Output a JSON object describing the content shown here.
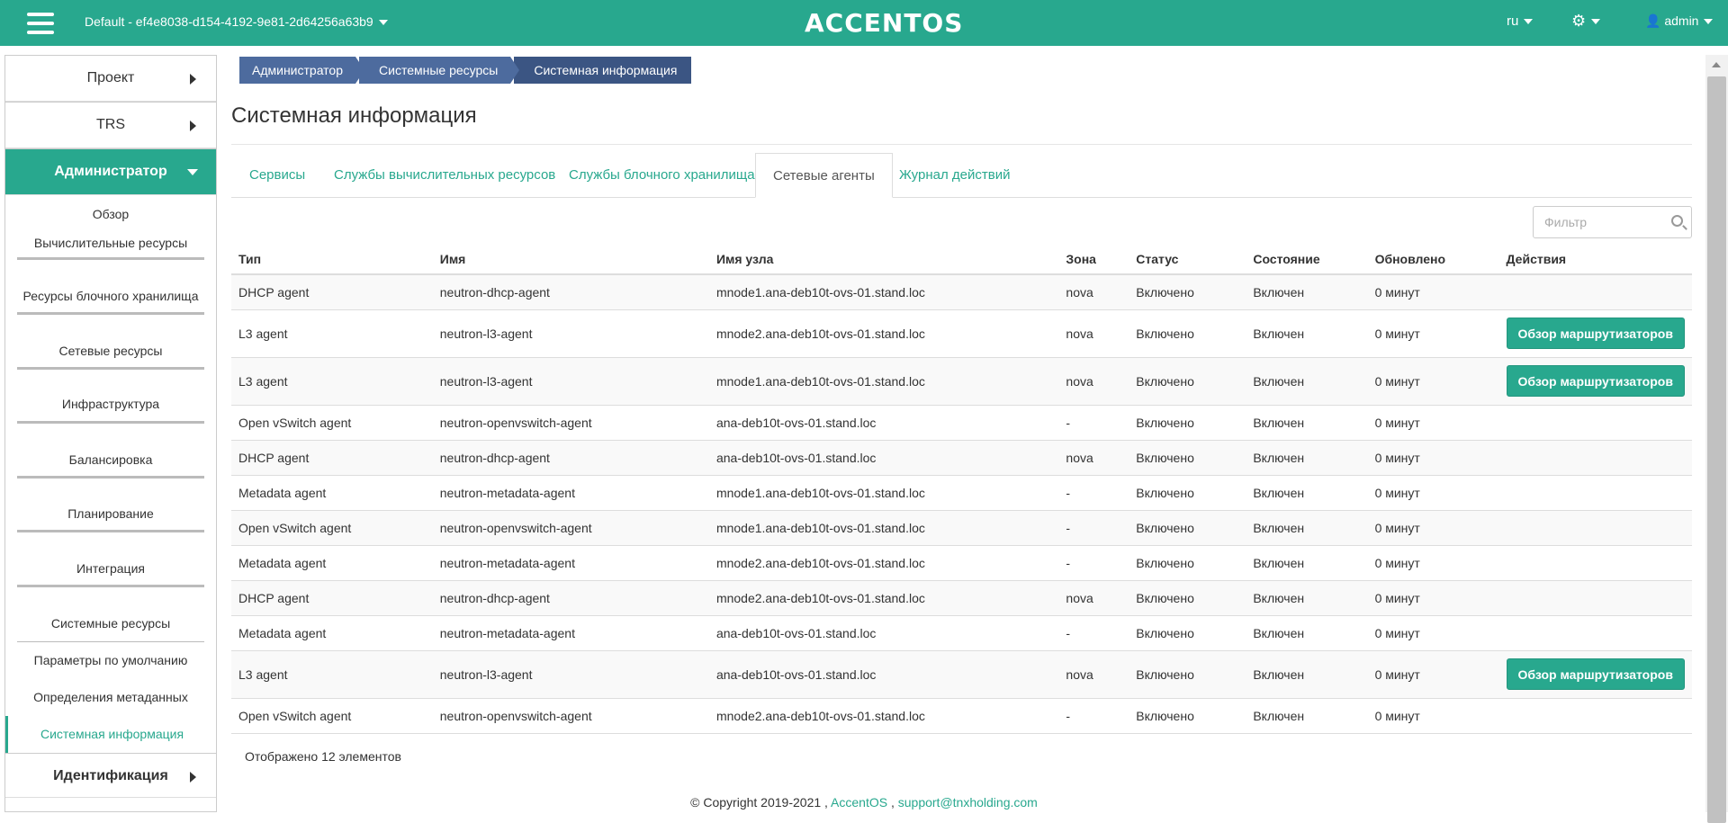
{
  "topbar": {
    "project": "Default - ef4e8038-d154-4192-9e81-2d64256a63b9",
    "logo": "ACCENTOS",
    "lang": "ru",
    "settings_icon": "gear-icon",
    "user": "admin",
    "color": "#28a88e"
  },
  "sidebar": {
    "sections": [
      {
        "label": "Проект"
      },
      {
        "label": "TRS"
      },
      {
        "label": "Администратор"
      }
    ],
    "items": [
      {
        "label": "Обзор"
      },
      {
        "label": "Вычислительные ресурсы"
      },
      {
        "label": "Ресурсы блочного хранилища"
      },
      {
        "label": "Сетевые ресурсы"
      },
      {
        "label": "Инфраструктура"
      },
      {
        "label": "Балансировка"
      },
      {
        "label": "Планирование"
      },
      {
        "label": "Интеграция"
      },
      {
        "label": "Системные ресурсы"
      }
    ],
    "subitems": [
      {
        "label": "Параметры по умолчанию"
      },
      {
        "label": "Определения метаданных"
      },
      {
        "label": "Системная информация"
      }
    ],
    "bottom_section": "Идентификация"
  },
  "breadcrumb": [
    "Администратор",
    "Системные ресурсы",
    "Системная информация"
  ],
  "page_title": "Системная информация",
  "tabs": [
    "Сервисы",
    "Службы вычислительных ресурсов",
    "Службы блочного хранилища",
    "Сетевые агенты",
    "Журнал действий"
  ],
  "filter": {
    "placeholder": "Фильтр"
  },
  "table": {
    "headers": [
      "Тип",
      "Имя",
      "Имя узла",
      "Зона",
      "Статус",
      "Состояние",
      "Обновлено",
      "Действия"
    ],
    "action_label": "Обзор маршрутизаторов",
    "rows": [
      {
        "type": "DHCP agent",
        "name": "neutron-dhcp-agent",
        "host": "mnode1.ana-deb10t-ovs-01.stand.loc",
        "zone": "nova",
        "status": "Включено",
        "state": "Включен",
        "updated": "0 минут",
        "action": false
      },
      {
        "type": "L3 agent",
        "name": "neutron-l3-agent",
        "host": "mnode2.ana-deb10t-ovs-01.stand.loc",
        "zone": "nova",
        "status": "Включено",
        "state": "Включен",
        "updated": "0 минут",
        "action": true
      },
      {
        "type": "L3 agent",
        "name": "neutron-l3-agent",
        "host": "mnode1.ana-deb10t-ovs-01.stand.loc",
        "zone": "nova",
        "status": "Включено",
        "state": "Включен",
        "updated": "0 минут",
        "action": true
      },
      {
        "type": "Open vSwitch agent",
        "name": "neutron-openvswitch-agent",
        "host": "ana-deb10t-ovs-01.stand.loc",
        "zone": "-",
        "status": "Включено",
        "state": "Включен",
        "updated": "0 минут",
        "action": false
      },
      {
        "type": "DHCP agent",
        "name": "neutron-dhcp-agent",
        "host": "ana-deb10t-ovs-01.stand.loc",
        "zone": "nova",
        "status": "Включено",
        "state": "Включен",
        "updated": "0 минут",
        "action": false
      },
      {
        "type": "Metadata agent",
        "name": "neutron-metadata-agent",
        "host": "mnode1.ana-deb10t-ovs-01.stand.loc",
        "zone": "-",
        "status": "Включено",
        "state": "Включен",
        "updated": "0 минут",
        "action": false
      },
      {
        "type": "Open vSwitch agent",
        "name": "neutron-openvswitch-agent",
        "host": "mnode1.ana-deb10t-ovs-01.stand.loc",
        "zone": "-",
        "status": "Включено",
        "state": "Включен",
        "updated": "0 минут",
        "action": false
      },
      {
        "type": "Metadata agent",
        "name": "neutron-metadata-agent",
        "host": "mnode2.ana-deb10t-ovs-01.stand.loc",
        "zone": "-",
        "status": "Включено",
        "state": "Включен",
        "updated": "0 минут",
        "action": false
      },
      {
        "type": "DHCP agent",
        "name": "neutron-dhcp-agent",
        "host": "mnode2.ana-deb10t-ovs-01.stand.loc",
        "zone": "nova",
        "status": "Включено",
        "state": "Включен",
        "updated": "0 минут",
        "action": false
      },
      {
        "type": "Metadata agent",
        "name": "neutron-metadata-agent",
        "host": "ana-deb10t-ovs-01.stand.loc",
        "zone": "-",
        "status": "Включено",
        "state": "Включен",
        "updated": "0 минут",
        "action": false
      },
      {
        "type": "L3 agent",
        "name": "neutron-l3-agent",
        "host": "ana-deb10t-ovs-01.stand.loc",
        "zone": "nova",
        "status": "Включено",
        "state": "Включен",
        "updated": "0 минут",
        "action": true
      },
      {
        "type": "Open vSwitch agent",
        "name": "neutron-openvswitch-agent",
        "host": "mnode2.ana-deb10t-ovs-01.stand.loc",
        "zone": "-",
        "status": "Включено",
        "state": "Включен",
        "updated": "0 минут",
        "action": false
      }
    ]
  },
  "count_text": "Отображено 12 элементов",
  "footer": {
    "copyright": "© Copyright 2019-2021 ,",
    "link1": "AccentOS",
    "sep": ",",
    "link2": "support@tnxholding.com"
  }
}
